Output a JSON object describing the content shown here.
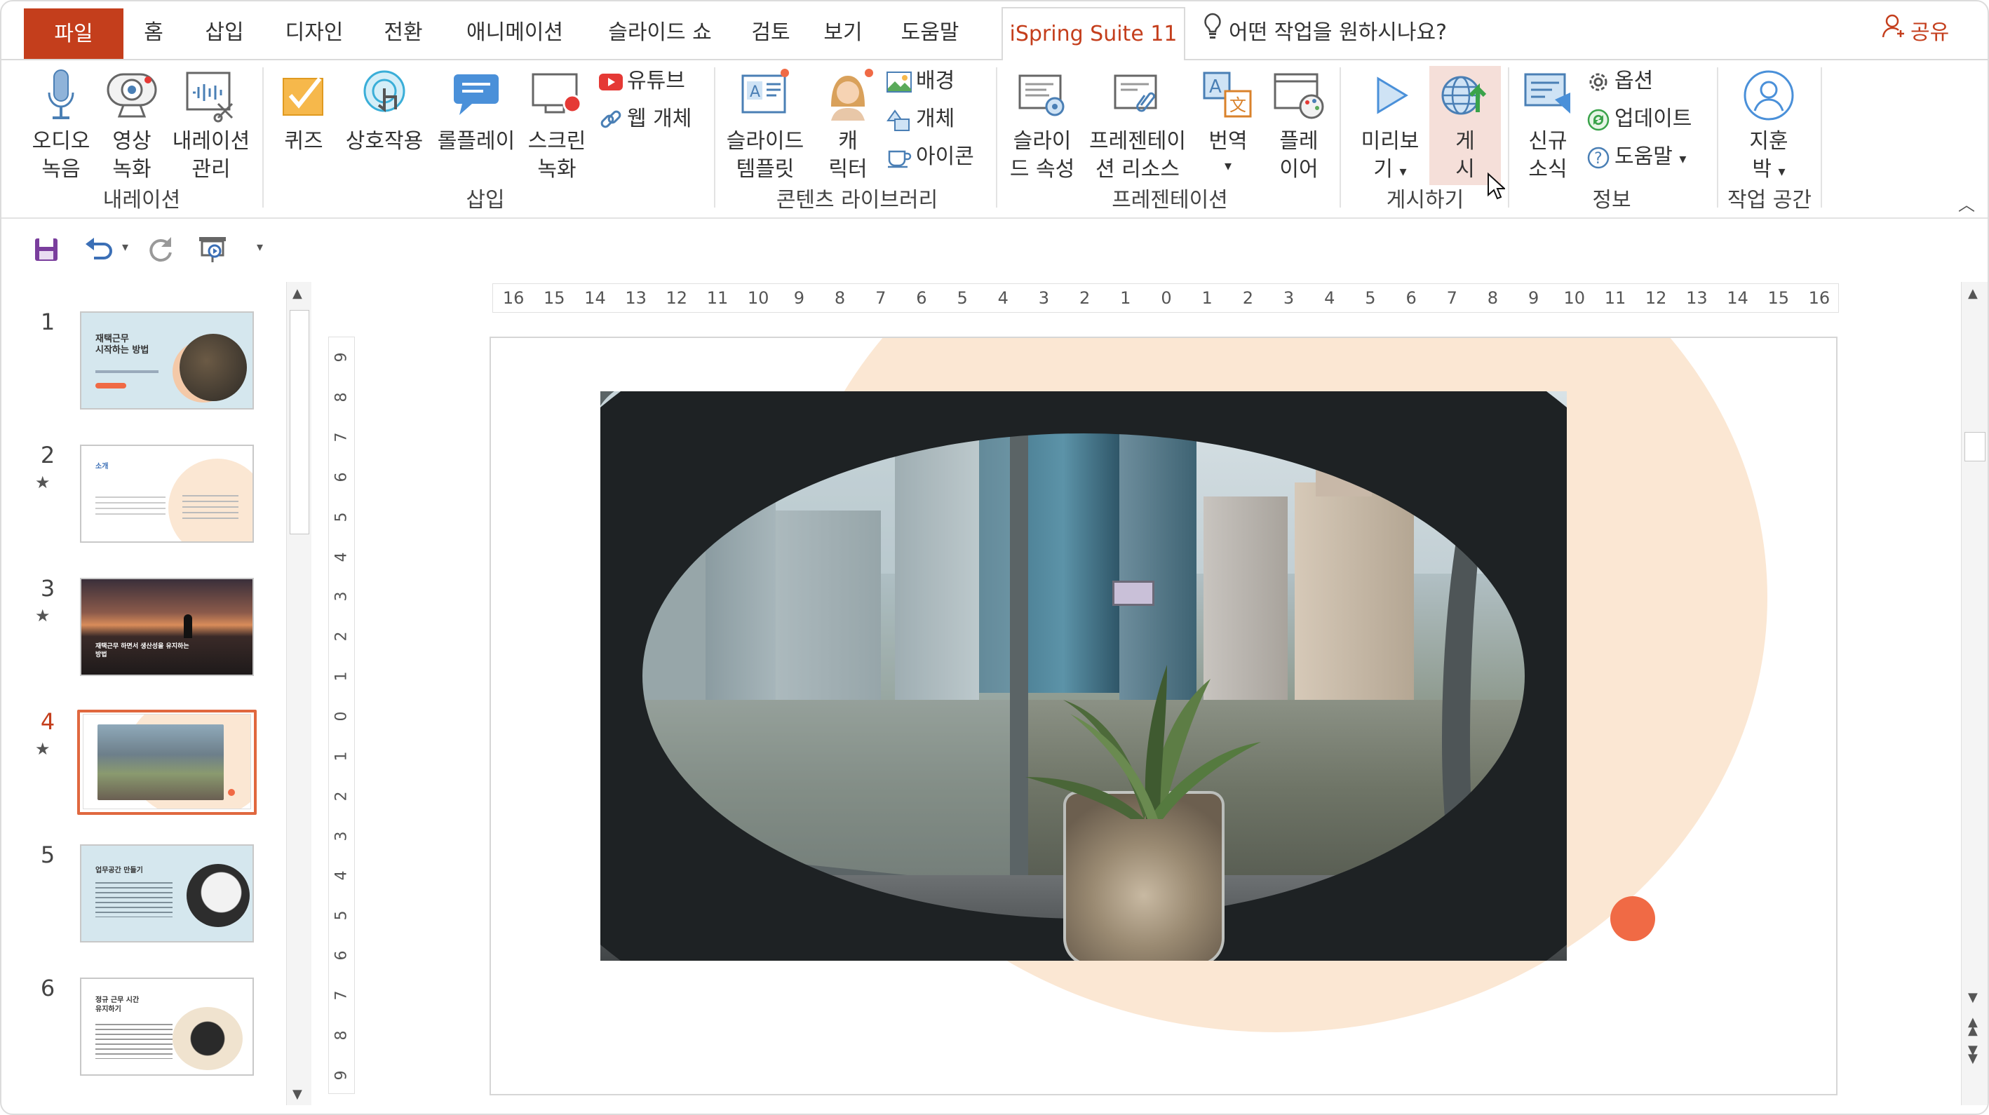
{
  "tabs": {
    "file": "파일",
    "home": "홈",
    "insert": "삽입",
    "design": "디자인",
    "transitions": "전환",
    "animations": "애니메이션",
    "slideshow": "슬라이드 쇼",
    "review": "검토",
    "view": "보기",
    "help": "도움말",
    "ispring": "iSpring Suite 11"
  },
  "tell_me": "어떤 작업을 원하시나요?",
  "share": "공유",
  "ribbon": {
    "narration": {
      "audio_1": "오디오",
      "audio_2": "녹음",
      "video_1": "영상",
      "video_2": "녹화",
      "manage_1": "내레이션",
      "manage_2": "관리",
      "group": "내레이션"
    },
    "insert": {
      "quiz": "퀴즈",
      "interaction": "상호작용",
      "roleplay": "롤플레이",
      "screen_1": "스크린",
      "screen_2": "녹화",
      "youtube": "유튜브",
      "web_object": "웹 개체",
      "group": "삽입"
    },
    "content_library": {
      "templates_1": "슬라이드",
      "templates_2": "템플릿",
      "character_1": "캐",
      "character_2": "릭터",
      "background": "배경",
      "objects": "개체",
      "icons": "아이콘",
      "group": "콘텐츠 라이브러리"
    },
    "presentation": {
      "properties_1": "슬라이",
      "properties_2": "드 속성",
      "resources_1": "프레젠테이",
      "resources_2": "션 리소스",
      "translate": "번역",
      "player_1": "플레",
      "player_2": "이어",
      "group": "프레젠테이션"
    },
    "publishing": {
      "preview_1": "미리보",
      "preview_2": "기",
      "publish_1": "게",
      "publish_2": "시",
      "group": "게시하기"
    },
    "info": {
      "news_1": "신규",
      "news_2": "소식",
      "options": "옵션",
      "updates": "업데이트",
      "help": "도움말",
      "group": "정보"
    },
    "workspace": {
      "user_1": "지훈",
      "user_2": "박",
      "group": "작업 공간"
    }
  },
  "slides": [
    {
      "num": "1",
      "title": "재택근무\n시작하는 방법",
      "starred": false
    },
    {
      "num": "2",
      "title": "소개",
      "starred": true
    },
    {
      "num": "3",
      "title": "재택근무 하면서 생산성을 유지하는 방법",
      "starred": true
    },
    {
      "num": "4",
      "title": "",
      "starred": true,
      "selected": true
    },
    {
      "num": "5",
      "title": "업무공간 만들기",
      "starred": false
    },
    {
      "num": "6",
      "title": "정규 근무 시간\n유지하기",
      "starred": false
    }
  ],
  "ruler_h": [
    "16",
    "15",
    "14",
    "13",
    "12",
    "11",
    "10",
    "9",
    "8",
    "7",
    "6",
    "5",
    "4",
    "3",
    "2",
    "1",
    "0",
    "1",
    "2",
    "3",
    "4",
    "5",
    "6",
    "7",
    "8",
    "9",
    "10",
    "11",
    "12",
    "13",
    "14",
    "15",
    "16"
  ],
  "ruler_v": [
    "9",
    "8",
    "7",
    "6",
    "5",
    "4",
    "3",
    "2",
    "1",
    "0",
    "1",
    "2",
    "3",
    "4",
    "5",
    "6",
    "7",
    "8",
    "9"
  ],
  "colors": {
    "accent": "#c43e1c",
    "selection": "#e0683f",
    "peach": "#fbe7d3",
    "dot": "#f06a45"
  }
}
